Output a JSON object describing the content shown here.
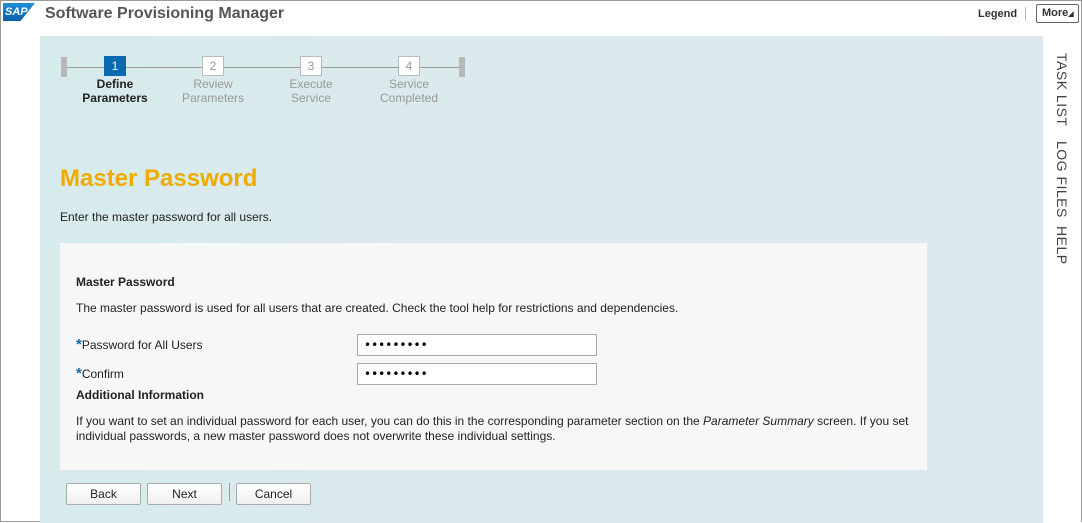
{
  "header": {
    "logo_text": "SAP",
    "app_title": "Software Provisioning Manager",
    "legend_label": "Legend",
    "more_label": "More",
    "more_icon": "triangle-down-icon"
  },
  "side_tabs": [
    "TASK LIST",
    "LOG FILES",
    "HELP"
  ],
  "steps": [
    {
      "number": "1",
      "line1": "Define",
      "line2": "Parameters",
      "active": true
    },
    {
      "number": "2",
      "line1": "Review",
      "line2": "Parameters",
      "active": false
    },
    {
      "number": "3",
      "line1": "Execute",
      "line2": "Service",
      "active": false
    },
    {
      "number": "4",
      "line1": "Service",
      "line2": "Completed",
      "active": false
    }
  ],
  "page": {
    "title": "Master Password",
    "intro": "Enter the master password for all users."
  },
  "panel": {
    "section_title": "Master Password",
    "description": "The master password is used for all users that are created. Check the tool help for restrictions and dependencies.",
    "fields": [
      {
        "label": "Password for All Users",
        "value": "•••••••••",
        "required_mark": "*"
      },
      {
        "label": "Confirm",
        "value": "•••••••••",
        "required_mark": "*"
      }
    ],
    "additional_title": "Additional Information",
    "additional_text_1": "If you want to set an individual password for each user, you can do this in the corresponding parameter section on the ",
    "additional_text_em": "Parameter Summary",
    "additional_text_2": " screen. If you set",
    "additional_text_3": "individual passwords, a new master password does not overwrite these individual settings."
  },
  "buttons": {
    "back": "Back",
    "next": "Next",
    "cancel": "Cancel"
  }
}
